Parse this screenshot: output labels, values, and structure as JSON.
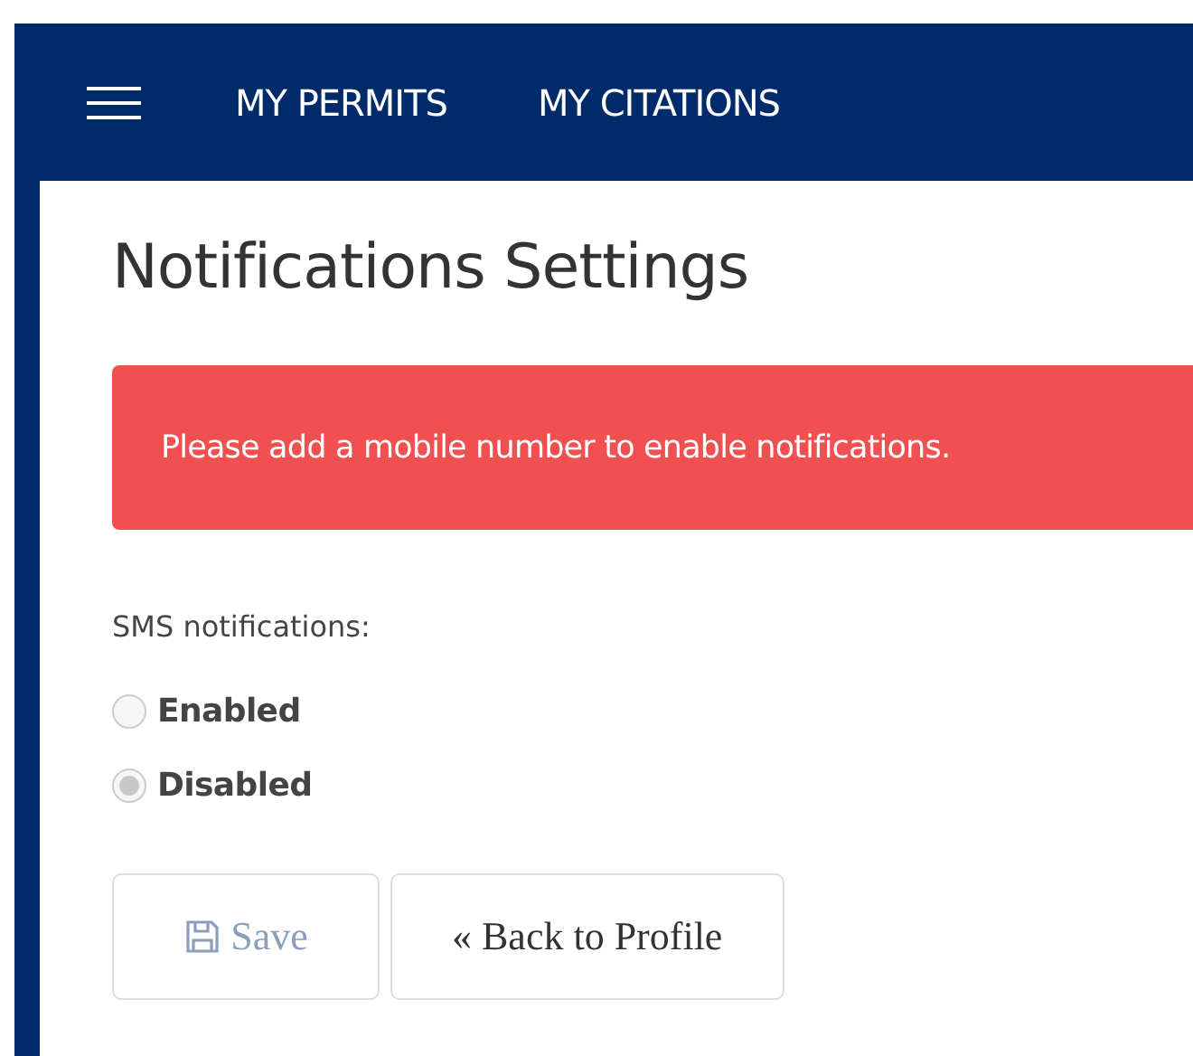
{
  "nav": {
    "items": [
      {
        "label": "MY PERMITS"
      },
      {
        "label": "MY CITATIONS"
      }
    ]
  },
  "page": {
    "title": "Notifications Settings",
    "alert": "Please add a mobile number to enable notifications.",
    "sms_label": "SMS notifications:",
    "options": [
      {
        "label": "Enabled",
        "selected": false
      },
      {
        "label": "Disabled",
        "selected": true
      }
    ],
    "buttons": [
      {
        "kind": "save",
        "label": "Save",
        "disabled": true
      },
      {
        "kind": "back",
        "label": "« Back to Profile",
        "disabled": false
      }
    ]
  }
}
